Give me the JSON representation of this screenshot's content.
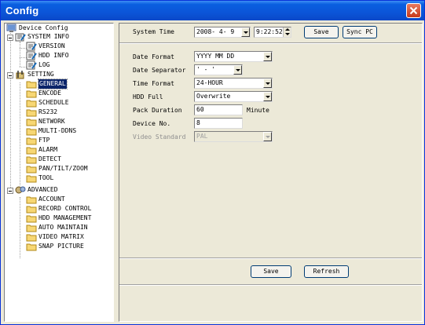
{
  "window": {
    "title": "Config"
  },
  "tree": {
    "root": "Device Config",
    "system_info": "SYSTEM INFO",
    "version": "VERSION",
    "hdd_info": "HDD INFO",
    "log": "LOG",
    "setting": "SETTING",
    "general": "GENERAL",
    "encode": "ENCODE",
    "schedule": "SCHEDULE",
    "rs232": "RS232",
    "network": "NETWORK",
    "multi_ddns": "MULTI-DDNS",
    "ftp": "FTP",
    "alarm": "ALARM",
    "detect": "DETECT",
    "ptz": "PAN/TILT/ZOOM",
    "tool": "TOOL",
    "advanced": "ADVANCED",
    "account": "ACCOUNT",
    "record_control": "RECORD CONTROL",
    "hdd_management": "HDD MANAGEMENT",
    "auto_maintain": "AUTO MAINTAIN",
    "video_matrix": "VIDEO MATRIX",
    "snap_picture": "SNAP PICTURE"
  },
  "system_time": {
    "label": "System Time",
    "date": "2008- 4- 9",
    "time": "9:22:52",
    "save_label": "Save",
    "sync_label": "Sync PC"
  },
  "form": {
    "date_format_label": "Date Format",
    "date_format_value": "YYYY MM DD",
    "date_separator_label": "Date Separator",
    "date_separator_value": "' - '",
    "time_format_label": "Time Format",
    "time_format_value": "24-HOUR",
    "hdd_full_label": "HDD Full",
    "hdd_full_value": "Overwrite",
    "pack_duration_label": "Pack Duration",
    "pack_duration_value": "60",
    "pack_duration_unit": "Minute",
    "device_no_label": "Device No.",
    "device_no_value": "8",
    "video_standard_label": "Video Standard",
    "video_standard_value": "PAL"
  },
  "footer": {
    "save_label": "Save",
    "refresh_label": "Refresh"
  }
}
